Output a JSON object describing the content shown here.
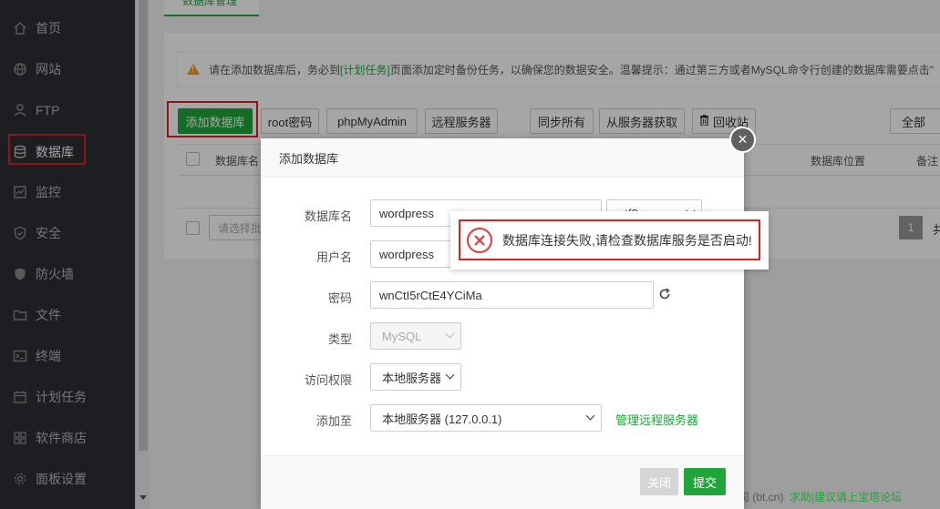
{
  "sidebar": {
    "items": [
      {
        "label": "首页",
        "icon": "home-icon"
      },
      {
        "label": "网站",
        "icon": "globe-icon"
      },
      {
        "label": "FTP",
        "icon": "ftp-icon"
      },
      {
        "label": "数据库",
        "icon": "database-icon"
      },
      {
        "label": "监控",
        "icon": "monitor-icon"
      },
      {
        "label": "安全",
        "icon": "shield-icon"
      },
      {
        "label": "防火墙",
        "icon": "firewall-icon"
      },
      {
        "label": "文件",
        "icon": "folder-icon"
      },
      {
        "label": "终端",
        "icon": "terminal-icon"
      },
      {
        "label": "计划任务",
        "icon": "calendar-icon"
      },
      {
        "label": "软件商店",
        "icon": "apps-icon"
      },
      {
        "label": "面板设置",
        "icon": "gear-icon"
      }
    ],
    "active": "数据库"
  },
  "page": {
    "tab": "数据库管理",
    "notice": {
      "pre": "请在添加数据库后，务必到",
      "link": "[计划任务]",
      "post": "页面添加定时备份任务，以确保您的数据安全。温馨提示：通过第三方或者MySQL命令行创建的数据库需要点击\""
    },
    "toolbar": {
      "add": "添加数据库",
      "root_pw": "root密码",
      "phpmyadmin": "phpMyAdmin",
      "remote": "远程服务器",
      "sync_all": "同步所有",
      "fetch": "从服务器获取",
      "recycle": "回收站",
      "filter": "全部"
    },
    "table": {
      "col_name": "数据库名",
      "col_location": "数据库位置",
      "col_note": "备注",
      "batch_placeholder": "请选择批"
    },
    "pager": {
      "current": "1",
      "tail": "共"
    }
  },
  "modal": {
    "title": "添加数据库",
    "close": "×",
    "fields": {
      "db_name_label": "数据库名",
      "db_name_value": "wordpress",
      "charset_value": "utf8",
      "user_label": "用户名",
      "user_value": "wordpress",
      "password_label": "密码",
      "password_value": "wnCtI5rCtE4YCiMa",
      "type_label": "类型",
      "type_value": "MySQL",
      "access_label": "访问权限",
      "access_value": "本地服务器",
      "add_to_label": "添加至",
      "add_to_value": "本地服务器 (127.0.0.1)",
      "manage_remote": "管理远程服务器"
    },
    "buttons": {
      "close": "关闭",
      "submit": "提交"
    }
  },
  "toast": {
    "message": "数据库连接失败,请检查数据库服务是否启动!"
  },
  "footer": {
    "text_left": "司 (bt.cn)",
    "text_link": "求助|建议请上宝塔论坛"
  },
  "colors": {
    "brand_green": "#20a53a",
    "sidebar_bg": "#2b2f33",
    "highlight_red": "#e02020",
    "error_red": "#e03a3a"
  }
}
